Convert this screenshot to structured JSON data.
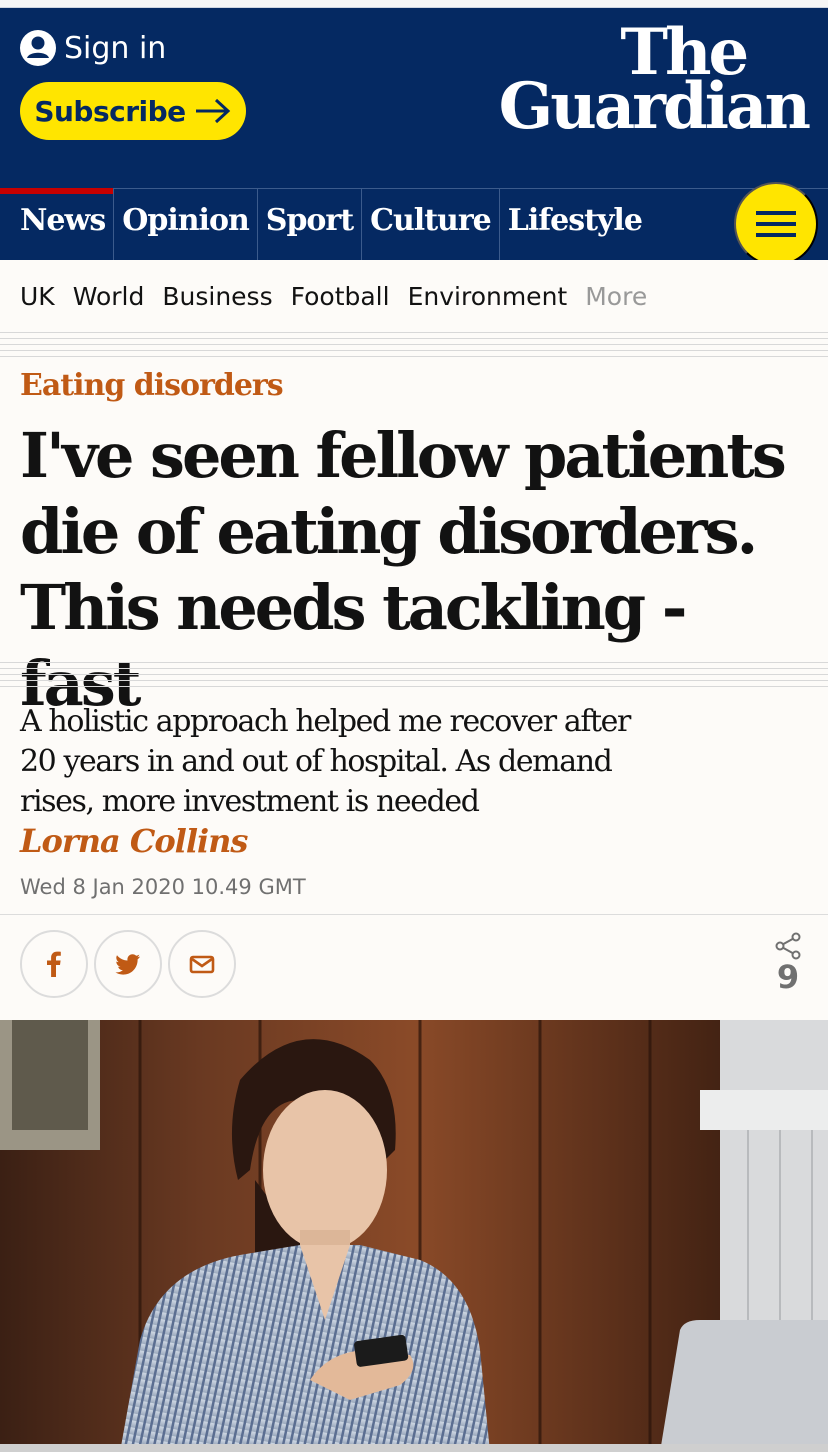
{
  "masthead": {
    "sign_in_label": "Sign in",
    "subscribe_label": "Subscribe",
    "logo_line1": "The",
    "logo_line2": "Guardian"
  },
  "pillars": {
    "items": [
      {
        "label": "News",
        "active": true
      },
      {
        "label": "Opinion"
      },
      {
        "label": "Sport"
      },
      {
        "label": "Culture"
      },
      {
        "label": "Lifestyle"
      }
    ]
  },
  "subnav": {
    "items": [
      "UK",
      "World",
      "Business",
      "Football",
      "Environment"
    ],
    "more": "More"
  },
  "article": {
    "kicker": "Eating disorders",
    "headline": "I've seen fellow patients die of eating disorders. This needs tackling - fast",
    "standfirst": "A holistic approach helped me recover after 20 years in and out of hospital. As demand rises, more investment is needed",
    "byline": "Lorna Collins",
    "dateline": "Wed 8 Jan 2020 10.49 GMT",
    "share_count": "9"
  },
  "icons": {
    "share_facebook": "facebook-icon",
    "share_twitter": "twitter-icon",
    "share_email": "email-icon",
    "share_generic": "share-icon",
    "menu": "hamburger-icon",
    "user": "user-icon"
  },
  "colors": {
    "brand_navy": "#052962",
    "brand_yellow": "#ffe500",
    "news_red": "#c70000",
    "lifestyle_accent": "#c05a15"
  }
}
